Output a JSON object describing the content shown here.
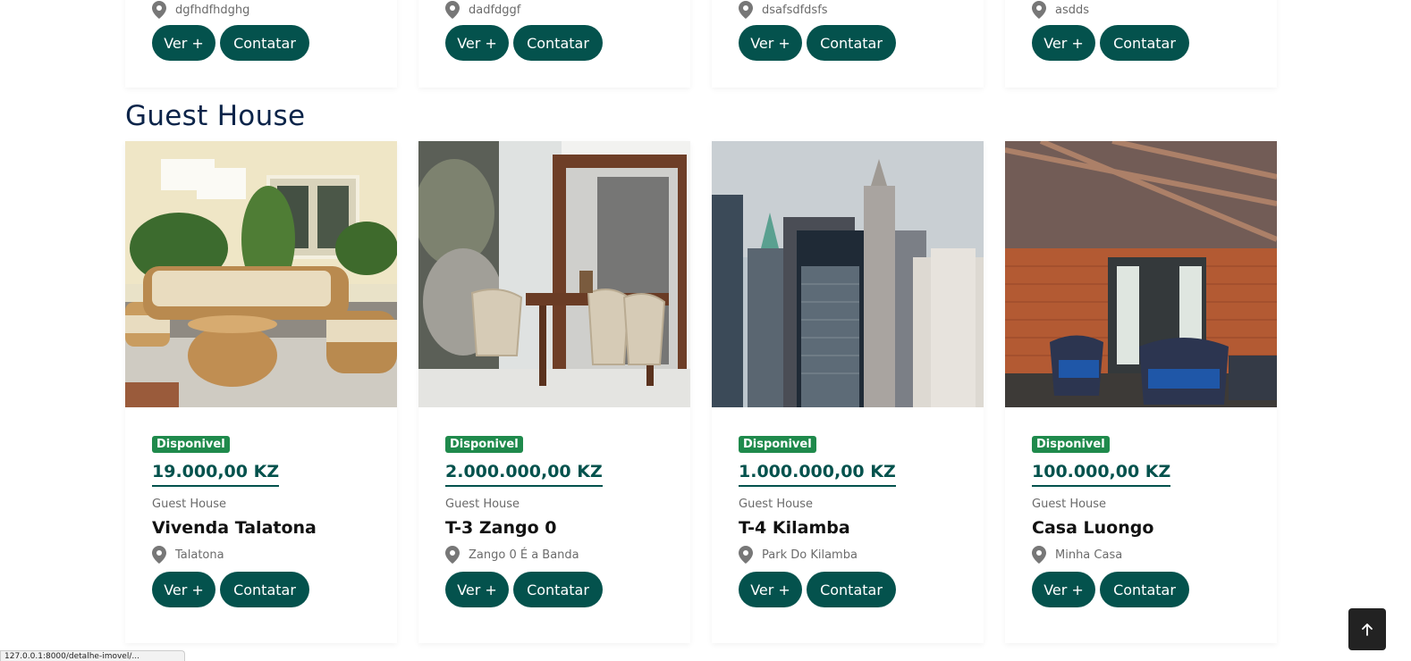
{
  "top_cards": [
    {
      "location": "dgfhdfhdghg",
      "ver_label": "Ver +",
      "contatar_label": "Contatar"
    },
    {
      "location": "dadfdggf",
      "ver_label": "Ver +",
      "contatar_label": "Contatar"
    },
    {
      "location": "dsafsdfdsfs",
      "ver_label": "Ver +",
      "contatar_label": "Contatar"
    },
    {
      "location": "asdds",
      "ver_label": "Ver +",
      "contatar_label": "Contatar"
    }
  ],
  "section": {
    "title": "Guest House"
  },
  "cards": [
    {
      "badge": "Disponivel",
      "price": "19.000,00 KZ",
      "type": "Guest House",
      "title": "Vivenda Talatona",
      "location": "Talatona",
      "ver_label": "Ver +",
      "contatar_label": "Contatar",
      "image": "patio-rattan-furniture"
    },
    {
      "badge": "Disponivel",
      "price": "2.000.000,00 KZ",
      "type": "Guest House",
      "title": "T-3 Zango 0",
      "location": "Zango 0 É a Banda",
      "ver_label": "Ver +",
      "contatar_label": "Contatar",
      "image": "dining-chairs-terrace"
    },
    {
      "badge": "Disponivel",
      "price": "1.000.000,00 KZ",
      "type": "Guest House",
      "title": "T-4 Kilamba",
      "location": "Park Do Kilamba",
      "ver_label": "Ver +",
      "contatar_label": "Contatar",
      "image": "city-skyscrapers"
    },
    {
      "badge": "Disponivel",
      "price": "100.000,00 KZ",
      "type": "Guest House",
      "title": "Casa Luongo",
      "location": "Minha Casa",
      "ver_label": "Ver +",
      "contatar_label": "Contatar",
      "image": "brick-patio-pergola"
    }
  ],
  "back_to_top": {
    "icon": "arrow-up-icon"
  },
  "colors": {
    "primary": "#04524d",
    "badge": "#1f8a4c",
    "heading": "#0c2449"
  },
  "status_bar": {
    "text": "127.0.0.1:8000/detalhe-imovel/..."
  }
}
